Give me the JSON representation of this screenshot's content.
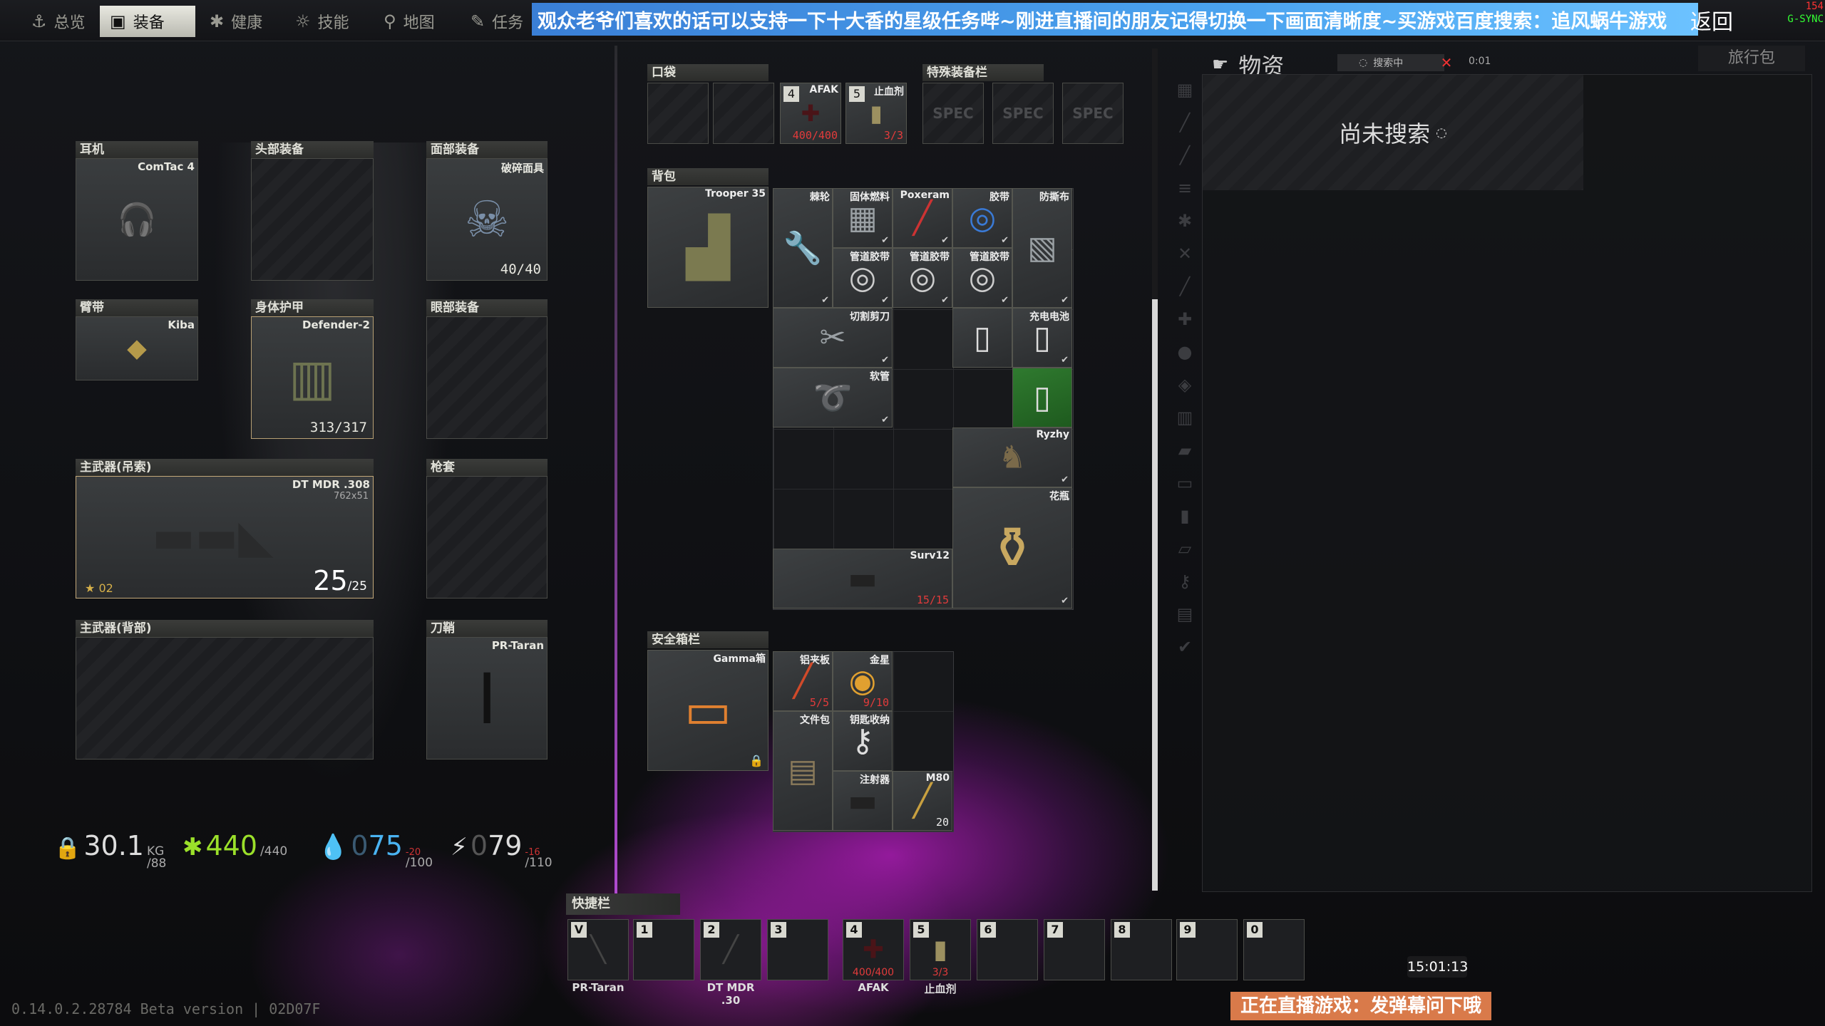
{
  "nav": {
    "tabs": [
      {
        "label": "总览",
        "icon": "anchor-icon"
      },
      {
        "label": "装备",
        "icon": "gear-icon"
      },
      {
        "label": "健康",
        "icon": "health-icon"
      },
      {
        "label": "技能",
        "icon": "skills-icon"
      },
      {
        "label": "地图",
        "icon": "map-pin-icon"
      },
      {
        "label": "任务",
        "icon": "tasks-icon"
      }
    ],
    "banner": "观众老爷们喜欢的话可以支持一下十大香的星级任务哔~刚进直播间的朋友记得切换一下画面清晰度~买游戏百度搜索：追风蜗牛游戏",
    "return_label": "返回",
    "fps": "154",
    "gsync": "G-SYNC"
  },
  "equipment": {
    "earpiece": {
      "label": "耳机",
      "item": "ComTac 4"
    },
    "headwear": {
      "label": "头部装备"
    },
    "faceCover": {
      "label": "面部装备",
      "item": "破碎面具",
      "durability": "40/40"
    },
    "armband": {
      "label": "臂带",
      "item": "Kiba"
    },
    "bodyArmor": {
      "label": "身体护甲",
      "item": "Defender-2",
      "durability": "313/317"
    },
    "eyewear": {
      "label": "眼部装备"
    },
    "primarySling": {
      "label": "主武器(吊索)",
      "item": "DT MDR .308",
      "caliber": "762x51",
      "ammo": "25",
      "ammo_max": "/25",
      "level": "02"
    },
    "holster": {
      "label": "枪套"
    },
    "primaryBack": {
      "label": "主武器(背部)"
    },
    "scabbard": {
      "label": "刀鞘",
      "item": "PR-Taran"
    }
  },
  "pockets": {
    "label": "口袋",
    "slots": [
      {
        "num": "4",
        "name": "AFAK",
        "count": "400/400"
      },
      {
        "num": "5",
        "name": "止血剂",
        "count": "3/3"
      }
    ]
  },
  "special": {
    "label": "特殊装备栏",
    "slot": "SPEC"
  },
  "backpack": {
    "label": "背包",
    "name": "Trooper 35",
    "items": [
      {
        "name": "棘轮"
      },
      {
        "name": "固体燃料"
      },
      {
        "name": "Poxeram"
      },
      {
        "name": "胶带"
      },
      {
        "name": "防撕布"
      },
      {
        "name": "管道胶带"
      },
      {
        "name": "管道胶带"
      },
      {
        "name": "管道胶带"
      },
      {
        "name": "切割剪刀"
      },
      {
        "name": "充电电池"
      },
      {
        "name": "软管"
      },
      {
        "name": "Ryzhy"
      },
      {
        "name": "花瓶"
      },
      {
        "name": "Surv12",
        "count": "15/15"
      }
    ]
  },
  "secure": {
    "label": "安全箱栏",
    "name": "Gamma箱",
    "items": [
      {
        "name": "铝夹板",
        "count": "5/5"
      },
      {
        "name": "金星",
        "count": "9/10"
      },
      {
        "name": "文件包"
      },
      {
        "name": "钥匙收纳"
      },
      {
        "name": "注射器"
      },
      {
        "name": "M80",
        "count": "20"
      }
    ]
  },
  "stats": {
    "weight": "30.1",
    "weight_unit": "KG",
    "weight_max": "/88",
    "health": "440",
    "health_max": "/440",
    "hydration": "75",
    "hydration_prefix": "0",
    "hydration_max": "/100",
    "hydration_delta": "-20",
    "energy": "79",
    "energy_prefix": "0",
    "energy_max": "/110",
    "energy_delta": "-16"
  },
  "loot": {
    "title": "物资",
    "search_label": "搜索中",
    "timer": "0:01",
    "bag_label": "旅行包",
    "not_searched": "尚未搜索"
  },
  "hotbar": {
    "label": "快捷栏",
    "slots": [
      {
        "num": "V",
        "name": "PR-Taran"
      },
      {
        "num": "1",
        "name": ""
      },
      {
        "num": "2",
        "name": "DT MDR .30"
      },
      {
        "num": "3",
        "name": ""
      },
      {
        "num": "4",
        "name": "AFAK",
        "count": "400/400"
      },
      {
        "num": "5",
        "name": "止血剂",
        "count": "3/3"
      },
      {
        "num": "6",
        "name": ""
      },
      {
        "num": "7",
        "name": ""
      },
      {
        "num": "8",
        "name": ""
      },
      {
        "num": "9",
        "name": ""
      },
      {
        "num": "0",
        "name": ""
      }
    ]
  },
  "clock": "15:01:13",
  "version": "0.14.0.2.28784 Beta version | 02D07F",
  "stream_notice": "正在直播游戏：发弹幕问下哦"
}
